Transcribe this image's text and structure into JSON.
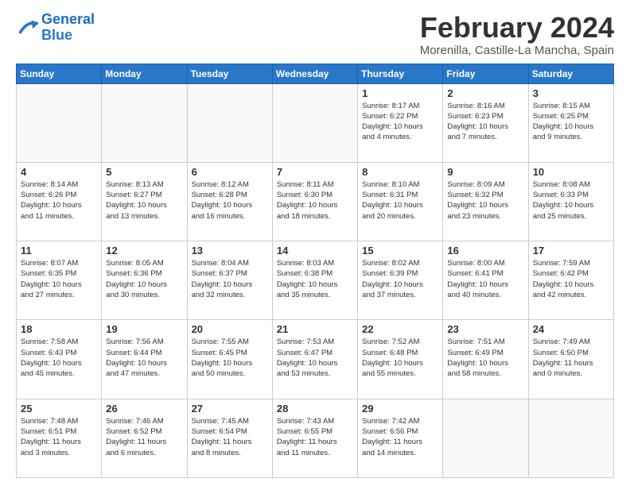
{
  "header": {
    "logo_line1": "General",
    "logo_line2": "Blue",
    "title": "February 2024",
    "subtitle": "Morenilla, Castille-La Mancha, Spain"
  },
  "days_of_week": [
    "Sunday",
    "Monday",
    "Tuesday",
    "Wednesday",
    "Thursday",
    "Friday",
    "Saturday"
  ],
  "weeks": [
    [
      {
        "day": "",
        "info": ""
      },
      {
        "day": "",
        "info": ""
      },
      {
        "day": "",
        "info": ""
      },
      {
        "day": "",
        "info": ""
      },
      {
        "day": "1",
        "info": "Sunrise: 8:17 AM\nSunset: 6:22 PM\nDaylight: 10 hours\nand 4 minutes."
      },
      {
        "day": "2",
        "info": "Sunrise: 8:16 AM\nSunset: 6:23 PM\nDaylight: 10 hours\nand 7 minutes."
      },
      {
        "day": "3",
        "info": "Sunrise: 8:15 AM\nSunset: 6:25 PM\nDaylight: 10 hours\nand 9 minutes."
      }
    ],
    [
      {
        "day": "4",
        "info": "Sunrise: 8:14 AM\nSunset: 6:26 PM\nDaylight: 10 hours\nand 11 minutes."
      },
      {
        "day": "5",
        "info": "Sunrise: 8:13 AM\nSunset: 6:27 PM\nDaylight: 10 hours\nand 13 minutes."
      },
      {
        "day": "6",
        "info": "Sunrise: 8:12 AM\nSunset: 6:28 PM\nDaylight: 10 hours\nand 16 minutes."
      },
      {
        "day": "7",
        "info": "Sunrise: 8:11 AM\nSunset: 6:30 PM\nDaylight: 10 hours\nand 18 minutes."
      },
      {
        "day": "8",
        "info": "Sunrise: 8:10 AM\nSunset: 6:31 PM\nDaylight: 10 hours\nand 20 minutes."
      },
      {
        "day": "9",
        "info": "Sunrise: 8:09 AM\nSunset: 6:32 PM\nDaylight: 10 hours\nand 23 minutes."
      },
      {
        "day": "10",
        "info": "Sunrise: 8:08 AM\nSunset: 6:33 PM\nDaylight: 10 hours\nand 25 minutes."
      }
    ],
    [
      {
        "day": "11",
        "info": "Sunrise: 8:07 AM\nSunset: 6:35 PM\nDaylight: 10 hours\nand 27 minutes."
      },
      {
        "day": "12",
        "info": "Sunrise: 8:05 AM\nSunset: 6:36 PM\nDaylight: 10 hours\nand 30 minutes."
      },
      {
        "day": "13",
        "info": "Sunrise: 8:04 AM\nSunset: 6:37 PM\nDaylight: 10 hours\nand 32 minutes."
      },
      {
        "day": "14",
        "info": "Sunrise: 8:03 AM\nSunset: 6:38 PM\nDaylight: 10 hours\nand 35 minutes."
      },
      {
        "day": "15",
        "info": "Sunrise: 8:02 AM\nSunset: 6:39 PM\nDaylight: 10 hours\nand 37 minutes."
      },
      {
        "day": "16",
        "info": "Sunrise: 8:00 AM\nSunset: 6:41 PM\nDaylight: 10 hours\nand 40 minutes."
      },
      {
        "day": "17",
        "info": "Sunrise: 7:59 AM\nSunset: 6:42 PM\nDaylight: 10 hours\nand 42 minutes."
      }
    ],
    [
      {
        "day": "18",
        "info": "Sunrise: 7:58 AM\nSunset: 6:43 PM\nDaylight: 10 hours\nand 45 minutes."
      },
      {
        "day": "19",
        "info": "Sunrise: 7:56 AM\nSunset: 6:44 PM\nDaylight: 10 hours\nand 47 minutes."
      },
      {
        "day": "20",
        "info": "Sunrise: 7:55 AM\nSunset: 6:45 PM\nDaylight: 10 hours\nand 50 minutes."
      },
      {
        "day": "21",
        "info": "Sunrise: 7:53 AM\nSunset: 6:47 PM\nDaylight: 10 hours\nand 53 minutes."
      },
      {
        "day": "22",
        "info": "Sunrise: 7:52 AM\nSunset: 6:48 PM\nDaylight: 10 hours\nand 55 minutes."
      },
      {
        "day": "23",
        "info": "Sunrise: 7:51 AM\nSunset: 6:49 PM\nDaylight: 10 hours\nand 58 minutes."
      },
      {
        "day": "24",
        "info": "Sunrise: 7:49 AM\nSunset: 6:50 PM\nDaylight: 11 hours\nand 0 minutes."
      }
    ],
    [
      {
        "day": "25",
        "info": "Sunrise: 7:48 AM\nSunset: 6:51 PM\nDaylight: 11 hours\nand 3 minutes."
      },
      {
        "day": "26",
        "info": "Sunrise: 7:46 AM\nSunset: 6:52 PM\nDaylight: 11 hours\nand 6 minutes."
      },
      {
        "day": "27",
        "info": "Sunrise: 7:45 AM\nSunset: 6:54 PM\nDaylight: 11 hours\nand 8 minutes."
      },
      {
        "day": "28",
        "info": "Sunrise: 7:43 AM\nSunset: 6:55 PM\nDaylight: 11 hours\nand 11 minutes."
      },
      {
        "day": "29",
        "info": "Sunrise: 7:42 AM\nSunset: 6:56 PM\nDaylight: 11 hours\nand 14 minutes."
      },
      {
        "day": "",
        "info": ""
      },
      {
        "day": "",
        "info": ""
      }
    ]
  ]
}
